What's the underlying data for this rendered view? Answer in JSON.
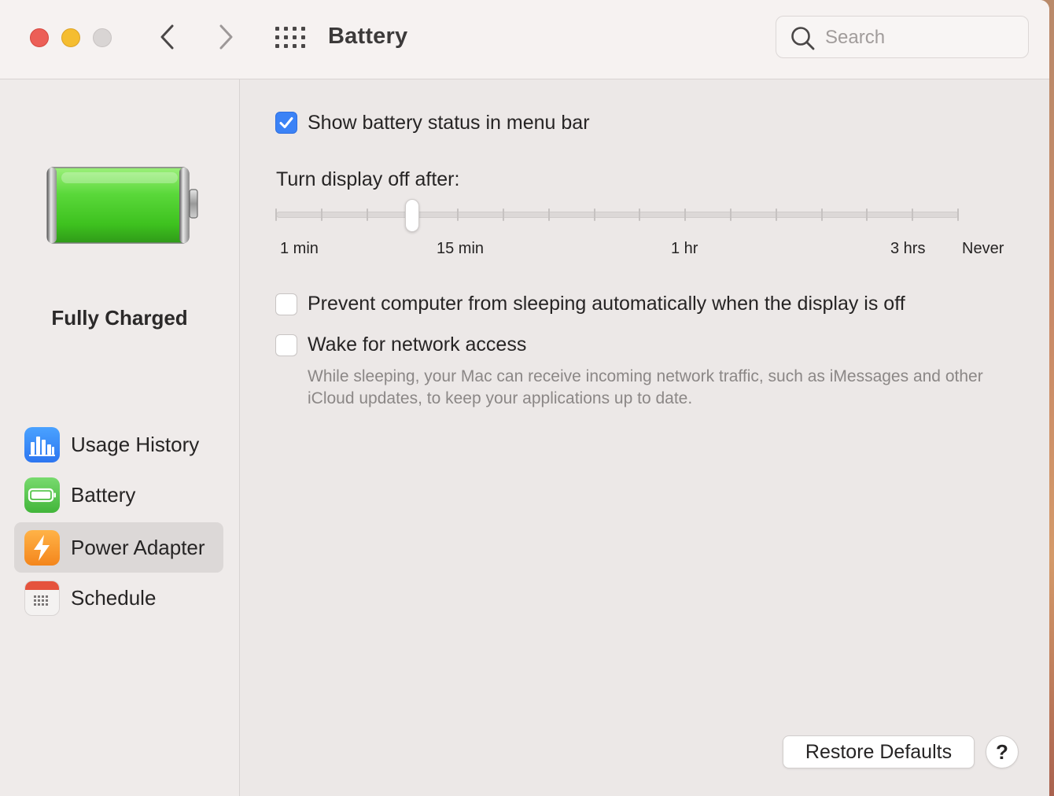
{
  "window": {
    "title": "Battery",
    "search": {
      "placeholder": "Search",
      "value": ""
    },
    "icons": {
      "back": "chevron-left-icon",
      "forward": "chevron-right-icon",
      "show_all": "grid-icon",
      "search": "search-icon"
    }
  },
  "sidebar": {
    "status_label": "Fully Charged",
    "items": [
      {
        "label": "Usage History",
        "icon": "bar-chart-icon",
        "selected": false
      },
      {
        "label": "Battery",
        "icon": "battery-icon",
        "selected": false
      },
      {
        "label": "Power Adapter",
        "icon": "lightning-bolt-icon",
        "selected": true
      },
      {
        "label": "Schedule",
        "icon": "calendar-icon",
        "selected": false
      }
    ]
  },
  "main": {
    "show_status": {
      "label": "Show battery status in menu bar",
      "checked": true
    },
    "display_off": {
      "label": "Turn display off after:",
      "tick_labels": [
        "1 min",
        "15 min",
        "1 hr",
        "3 hrs",
        "Never"
      ],
      "tick_count": 16,
      "selected_index": 3
    },
    "prevent_sleep": {
      "label": "Prevent computer from sleeping automatically when the display is off",
      "checked": false
    },
    "wake_network": {
      "label": "Wake for network access",
      "checked": false,
      "description": "While sleeping, your Mac can receive incoming network traffic, such as iMessages and other iCloud updates, to keep your applications up to date."
    },
    "restore_defaults": "Restore Defaults",
    "help": "?"
  },
  "colors": {
    "accent": "#3b82f6",
    "close": "#ec5f57",
    "minimize": "#f5bd30",
    "battery_fill": "#3ec21f"
  }
}
